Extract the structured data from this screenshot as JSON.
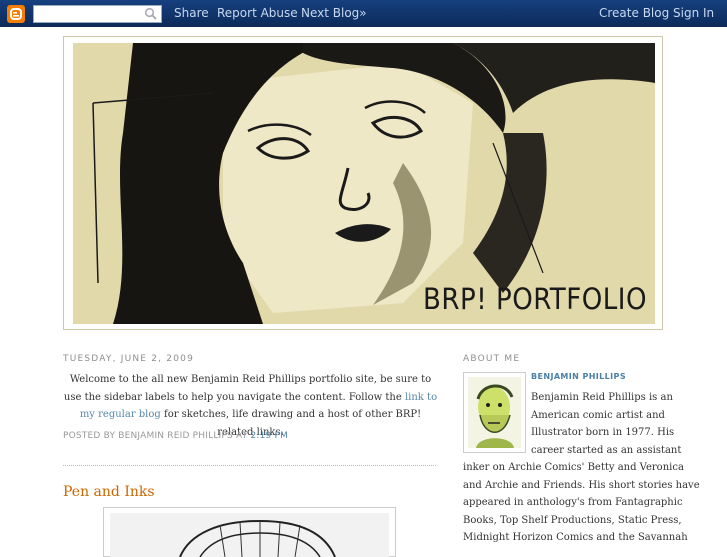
{
  "navbar": {
    "search_value": "",
    "links": [
      {
        "label": "Share"
      },
      {
        "label": "Report Abuse"
      },
      {
        "label": "Next Blog»"
      }
    ],
    "right_links": [
      {
        "label": "Create Blog"
      },
      {
        "label": "Sign In"
      }
    ],
    "colors": {
      "bar": "#0d2d5e",
      "logo": "#f57d00"
    }
  },
  "header": {
    "title": "BRP! PORTFOLIO"
  },
  "post": {
    "date": "Tuesday, June 2, 2009",
    "body_part1": "Welcome to the all new Benjamin Reid Phillips portfolio site, be sure to use the sidebar labels to help you navigate the content. Follow the ",
    "body_link": "link to my regular blog",
    "body_part2": " for sketches, life drawing and a host of other BRP! related links.",
    "footer_prefix": "Posted by Benjamin Reid Phillips at",
    "footer_time": "2:19 PM"
  },
  "post2": {
    "title": "Pen and Inks"
  },
  "sidebar": {
    "about_header": "About Me",
    "name": "Benjamin Phillips",
    "about_lines": [
      "Benjamin Reid Phillips is an",
      "American comic artist and",
      "Illustrator born in 1977. His",
      "career started as an assistant",
      "inker on Archie Comics' Betty and Veronica",
      "and Archie and Friends. His short stories have",
      "appeared in anthology's from Fantagraphic",
      "Books, Top Shelf Productions, Static Press,",
      "Midnight Horizon Comics and the Savannah"
    ]
  }
}
